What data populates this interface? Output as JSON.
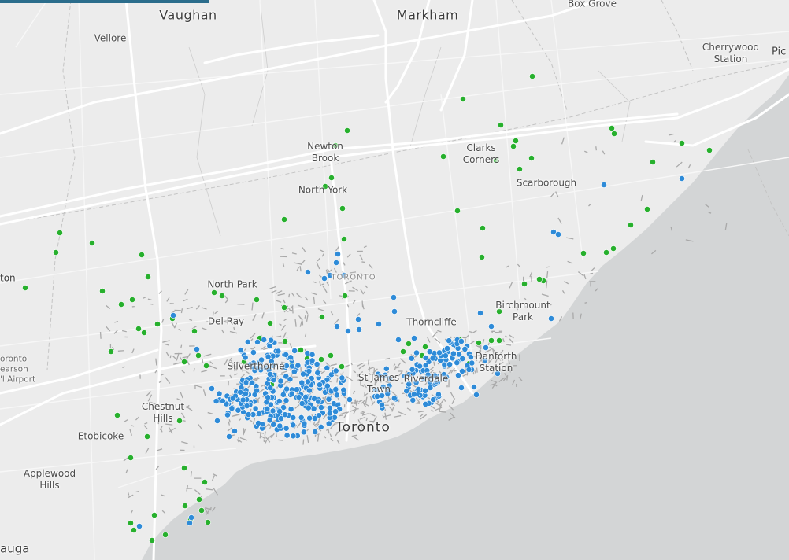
{
  "map": {
    "colors": {
      "land": "#ececec",
      "water": "#d3d5d6",
      "road_major": "#ffffff",
      "road_minor": "#f7f7f7",
      "boundary": "#c4c4c4",
      "building": "#a9a9a9",
      "blue_marker": "#2e8bd8",
      "green_marker": "#27b02d"
    },
    "labels": {
      "vaughan": "Vaughan",
      "markham": "Markham",
      "box_grove": "Box Grove",
      "vellore": "Vellore",
      "cherrywood": "Cherrywood\nStation",
      "pic": "Pic",
      "newton_brook": "Newton\nBrook",
      "clarks_corners": "Clarks\nCorners",
      "north_york": "North York",
      "scarborough": "Scarborough",
      "ton": "ton",
      "north_park": "North Park",
      "toronto_upper": "TORONTO",
      "birchmount_park": "Birchmount\nPark",
      "del_ray": "Del Ray",
      "thorncliffe": "Thorncliffe",
      "airport": "oronto\nearson\n'l Airport",
      "danforth_station": "Danforth\nStation",
      "silverthorne": "Silverthorne",
      "st_james_town": "St James\nTown",
      "riverdale": "Riverdale",
      "chestnut_hills": "Chestnut\nHills",
      "toronto": "Toronto",
      "etobicoke": "Etobicoke",
      "applewood_hills": "Applewood\nHills",
      "auga": "auga"
    },
    "marker_layers": [
      {
        "name": "blue-markers",
        "color_key": "blue_marker"
      },
      {
        "name": "green-markers",
        "color_key": "green_marker"
      }
    ]
  }
}
